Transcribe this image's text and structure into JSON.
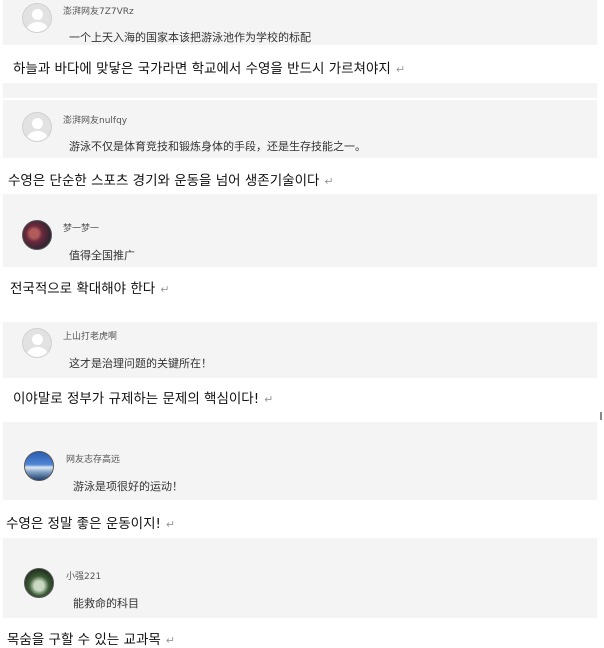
{
  "return_mark": "↵",
  "comments": [
    {
      "username": "澎湃网友7Z7VRz",
      "text": "一个上天入海的国家本该把游泳池作为学校的标配",
      "translation": "하늘과 바다에 맞닿은 국가라면 학교에서 수영을 반드시 가르쳐야지"
    },
    {
      "username": "澎湃网友nulfqy",
      "text": "游泳不仅是体育竞技和锻炼身体的手段，还是生存技能之一。",
      "translation": "수영은 단순한 스포츠 경기와 운동을 넘어 생존기술이다"
    },
    {
      "username": "梦一梦一",
      "text": "值得全国推广",
      "translation": "전국적으로 확대해야 한다"
    },
    {
      "username": "上山打老虎啊",
      "text": "这才是治理问题的关键所在！",
      "translation": "이야말로 정부가 규제하는 문제의 핵심이다!"
    },
    {
      "username": "网友志存高远",
      "text": "游泳是项很好的运动！",
      "translation": "수영은 정말 좋은 운동이지!"
    },
    {
      "username": "小强221",
      "text": "能救命的科目",
      "translation": "목숨을 구할 수 있는 교과목"
    }
  ]
}
